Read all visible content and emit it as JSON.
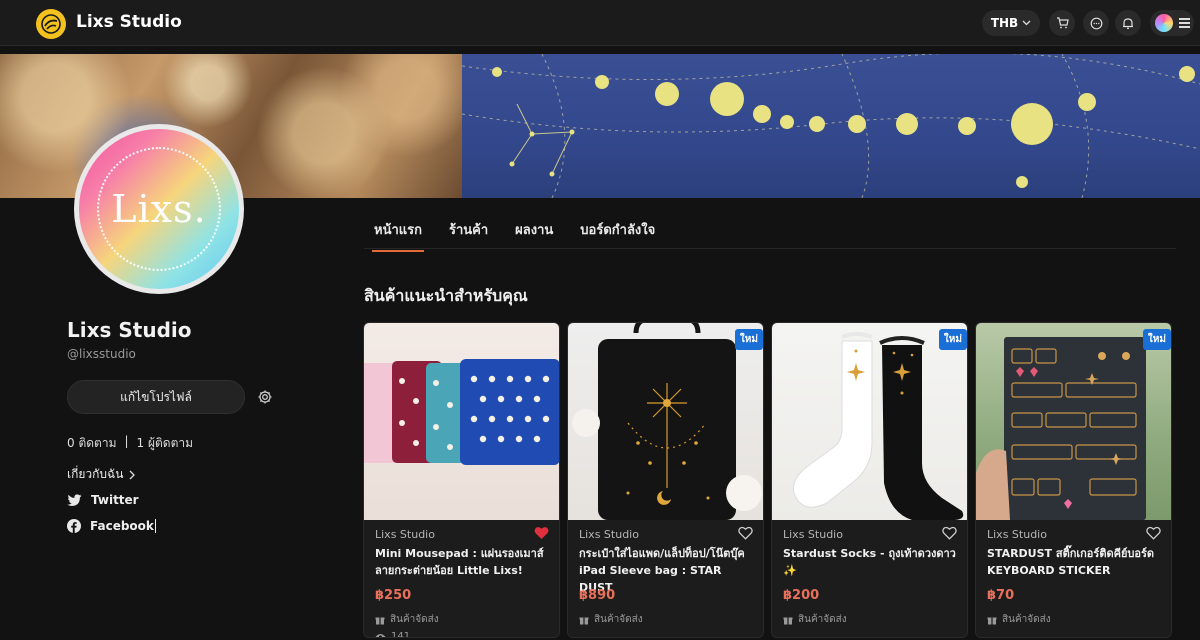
{
  "header": {
    "brand": "Lixs Studio",
    "currency": "THB",
    "icons": [
      "cart-icon",
      "chat-icon",
      "bell-icon",
      "menu-icon"
    ],
    "accent": "#f4c21e"
  },
  "profile": {
    "logo_text": "Lixs.",
    "name": "Lixs Studio",
    "handle": "@lixsstudio",
    "edit_label": "แก้ไขโปรไฟล์",
    "following": "0 ติดตาม",
    "separator": "|",
    "followers": "1 ผู้ติดตาม",
    "about_label": "เกี่ยวกับฉัน",
    "socials": [
      {
        "name": "Twitter",
        "icon": "twitter-icon"
      },
      {
        "name": "Facebook",
        "icon": "facebook-icon"
      }
    ]
  },
  "tabs": [
    {
      "label": "หน้าแรก",
      "active": true
    },
    {
      "label": "ร้านค้า",
      "active": false
    },
    {
      "label": "ผลงาน",
      "active": false
    },
    {
      "label": "บอร์ดกำลังใจ",
      "active": false
    }
  ],
  "section_title": "สินค้าแนะนำสำหรับคุณ",
  "products": [
    {
      "shop": "Lixs Studio",
      "title": "Mini Mousepad : แผ่นรองเมาส์ลายกระต่ายน้อย Little Lixs!",
      "price": "฿250",
      "shipping": "สินค้าจัดส่ง",
      "views": "141",
      "new_badge": "",
      "liked": true
    },
    {
      "shop": "Lixs Studio",
      "title": "กระเป๋าใส่ไอแพด/แล็ปท็อป/โน๊ตบุ๊ค iPad Sleeve bag : STAR DUST",
      "price": "฿890",
      "shipping": "สินค้าจัดส่ง",
      "views": "",
      "new_badge": "ใหม่",
      "liked": false
    },
    {
      "shop": "Lixs Studio",
      "title": "Stardust Socks - ถุงเท้าดวงดาว ✨",
      "price": "฿200",
      "shipping": "สินค้าจัดส่ง",
      "views": "",
      "new_badge": "ใหม่",
      "liked": false
    },
    {
      "shop": "Lixs Studio",
      "title": "STARDUST สติ๊กเกอร์ติดคีย์บอร์ด KEYBOARD STICKER",
      "price": "฿70",
      "shipping": "สินค้าจัดส่ง",
      "views": "",
      "new_badge": "ใหม่",
      "liked": false
    }
  ],
  "colors": {
    "price": "#e9705a",
    "tab_underline": "#e16c3a",
    "badge": "#1a6fd6",
    "liked_heart": "#e0303d"
  }
}
